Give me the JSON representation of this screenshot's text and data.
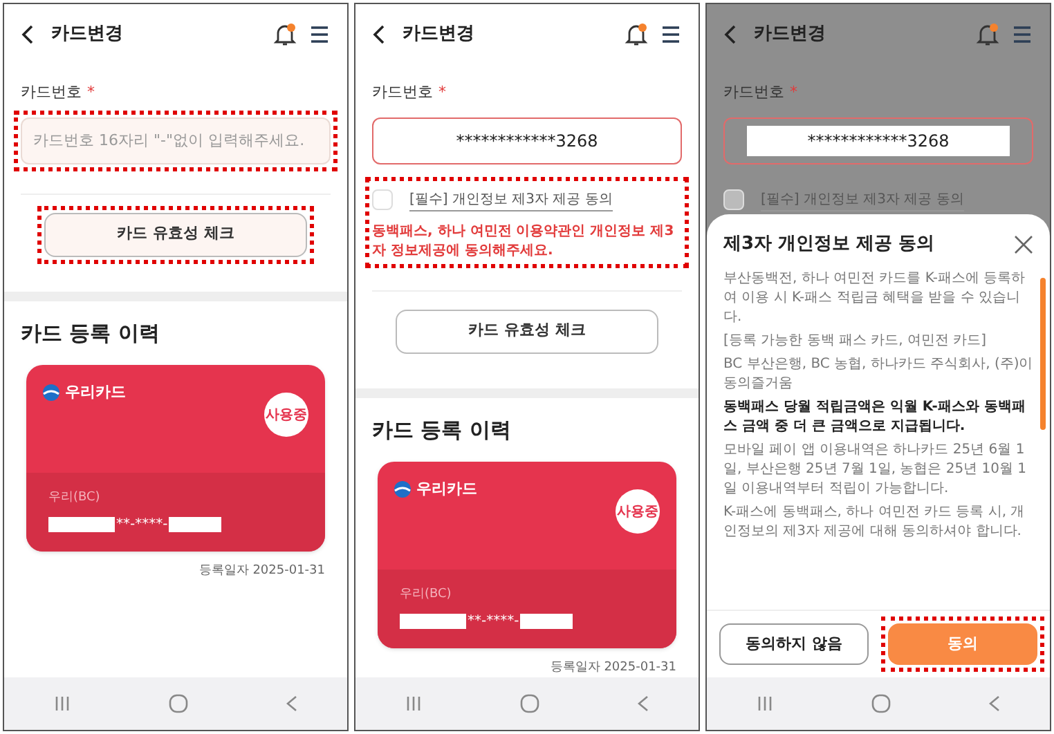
{
  "screens": [
    {
      "dimmed": false,
      "header": {
        "title": "카드변경"
      },
      "card_number": {
        "label": "카드번호",
        "required": "*",
        "placeholder": "카드번호 16자리 \"-\"없이 입력해주세요.",
        "error": false,
        "highlighted": true
      },
      "check_button": {
        "label": "카드 유효성 체크",
        "highlighted": true
      },
      "history": {
        "title": "카드 등록 이력",
        "card": {
          "brand": "우리카드",
          "status": "사용중",
          "issuer": "우리(BC)",
          "number": "**-****-",
          "date": "등록일자 2025-01-31"
        }
      }
    },
    {
      "dimmed": false,
      "header": {
        "title": "카드변경"
      },
      "card_number": {
        "label": "카드번호",
        "required": "*",
        "value": "************3268",
        "error": true,
        "highlighted": false
      },
      "consent": {
        "label": "[필수] 개인정보 제3자 제공 동의",
        "checked": false,
        "error": "동백패스, 하나 여민전 이용약관인 개인정보 제3자 정보제공에 동의해주세요.",
        "highlighted": true
      },
      "check_button": {
        "label": "카드 유효성 체크",
        "highlighted": false
      },
      "history": {
        "title": "카드 등록 이력",
        "card": {
          "brand": "우리카드",
          "status": "사용중",
          "issuer": "우리(BC)",
          "number": "**-****-",
          "date": "등록일자 2025-01-31"
        }
      }
    },
    {
      "dimmed": true,
      "header": {
        "title": "카드변경"
      },
      "card_number": {
        "label": "카드번호",
        "required": "*",
        "value": "************3268",
        "error": true,
        "highlighted": false
      },
      "consent": {
        "label": "[필수] 개인정보 제3자 제공 동의",
        "checked": false
      },
      "modal": {
        "title": "제3자 개인정보 제공 동의",
        "paragraphs": [
          {
            "text": "부산동백전, 하나 여민전 카드를 K-패스에 등록하여 이용 시 K-패스 적립금 혜택을 받을 수 있습니다.",
            "bold": false
          },
          {
            "text": "[등록 가능한 동백 패스 카드, 여민전 카드]",
            "bold": false
          },
          {
            "text": "BC 부산은행, BC 농협, 하나카드 주식회사, (주)이동의즐거움",
            "bold": false
          },
          {
            "text": "동백패스 당월 적립금액은 익월 K-패스와 동백패스 금액 중 더 큰 금액으로 지급됩니다.",
            "bold": true
          },
          {
            "text": "모바일 페이 앱 이용내역은 하나카드 25년 6월 1일, 부산은행 25년 7월 1일, 농협은 25년 10월 1일 이용내역부터 적립이 가능합니다.",
            "bold": false
          },
          {
            "text": "K-패스에 동백패스, 하나 여민전 카드 등록 시, 개인정보의 제3자 제공에 대해 동의하셔야 합니다.",
            "bold": false
          }
        ],
        "buttons": [
          {
            "label": "동의하지 않음",
            "kind": "secondary",
            "highlighted": false
          },
          {
            "label": "동의",
            "kind": "primary",
            "highlighted": true
          }
        ]
      }
    }
  ]
}
